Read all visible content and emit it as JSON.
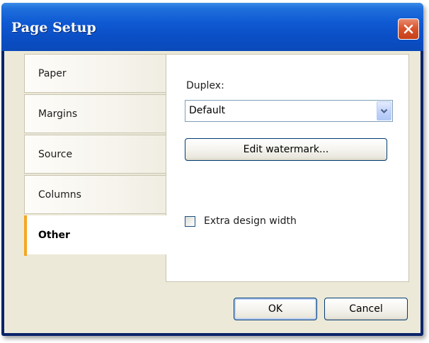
{
  "window": {
    "title": "Page Setup"
  },
  "tabs": [
    {
      "label": "Paper",
      "active": false
    },
    {
      "label": "Margins",
      "active": false
    },
    {
      "label": "Source",
      "active": false
    },
    {
      "label": "Columns",
      "active": false
    },
    {
      "label": "Other",
      "active": true
    }
  ],
  "other_panel": {
    "duplex_label": "Duplex:",
    "duplex_value": "Default",
    "edit_watermark_label": "Edit watermark...",
    "extra_design_width_label": "Extra design width",
    "extra_design_width_checked": false
  },
  "footer": {
    "ok_label": "OK",
    "cancel_label": "Cancel"
  },
  "colors": {
    "titlebar": "#0b4fc6",
    "close_button": "#d9552e",
    "dialog_background": "#ece9d8",
    "active_tab_marker": "#f5a623"
  },
  "icons": {
    "close": "close-icon",
    "dropdown": "chevron-down-icon"
  }
}
